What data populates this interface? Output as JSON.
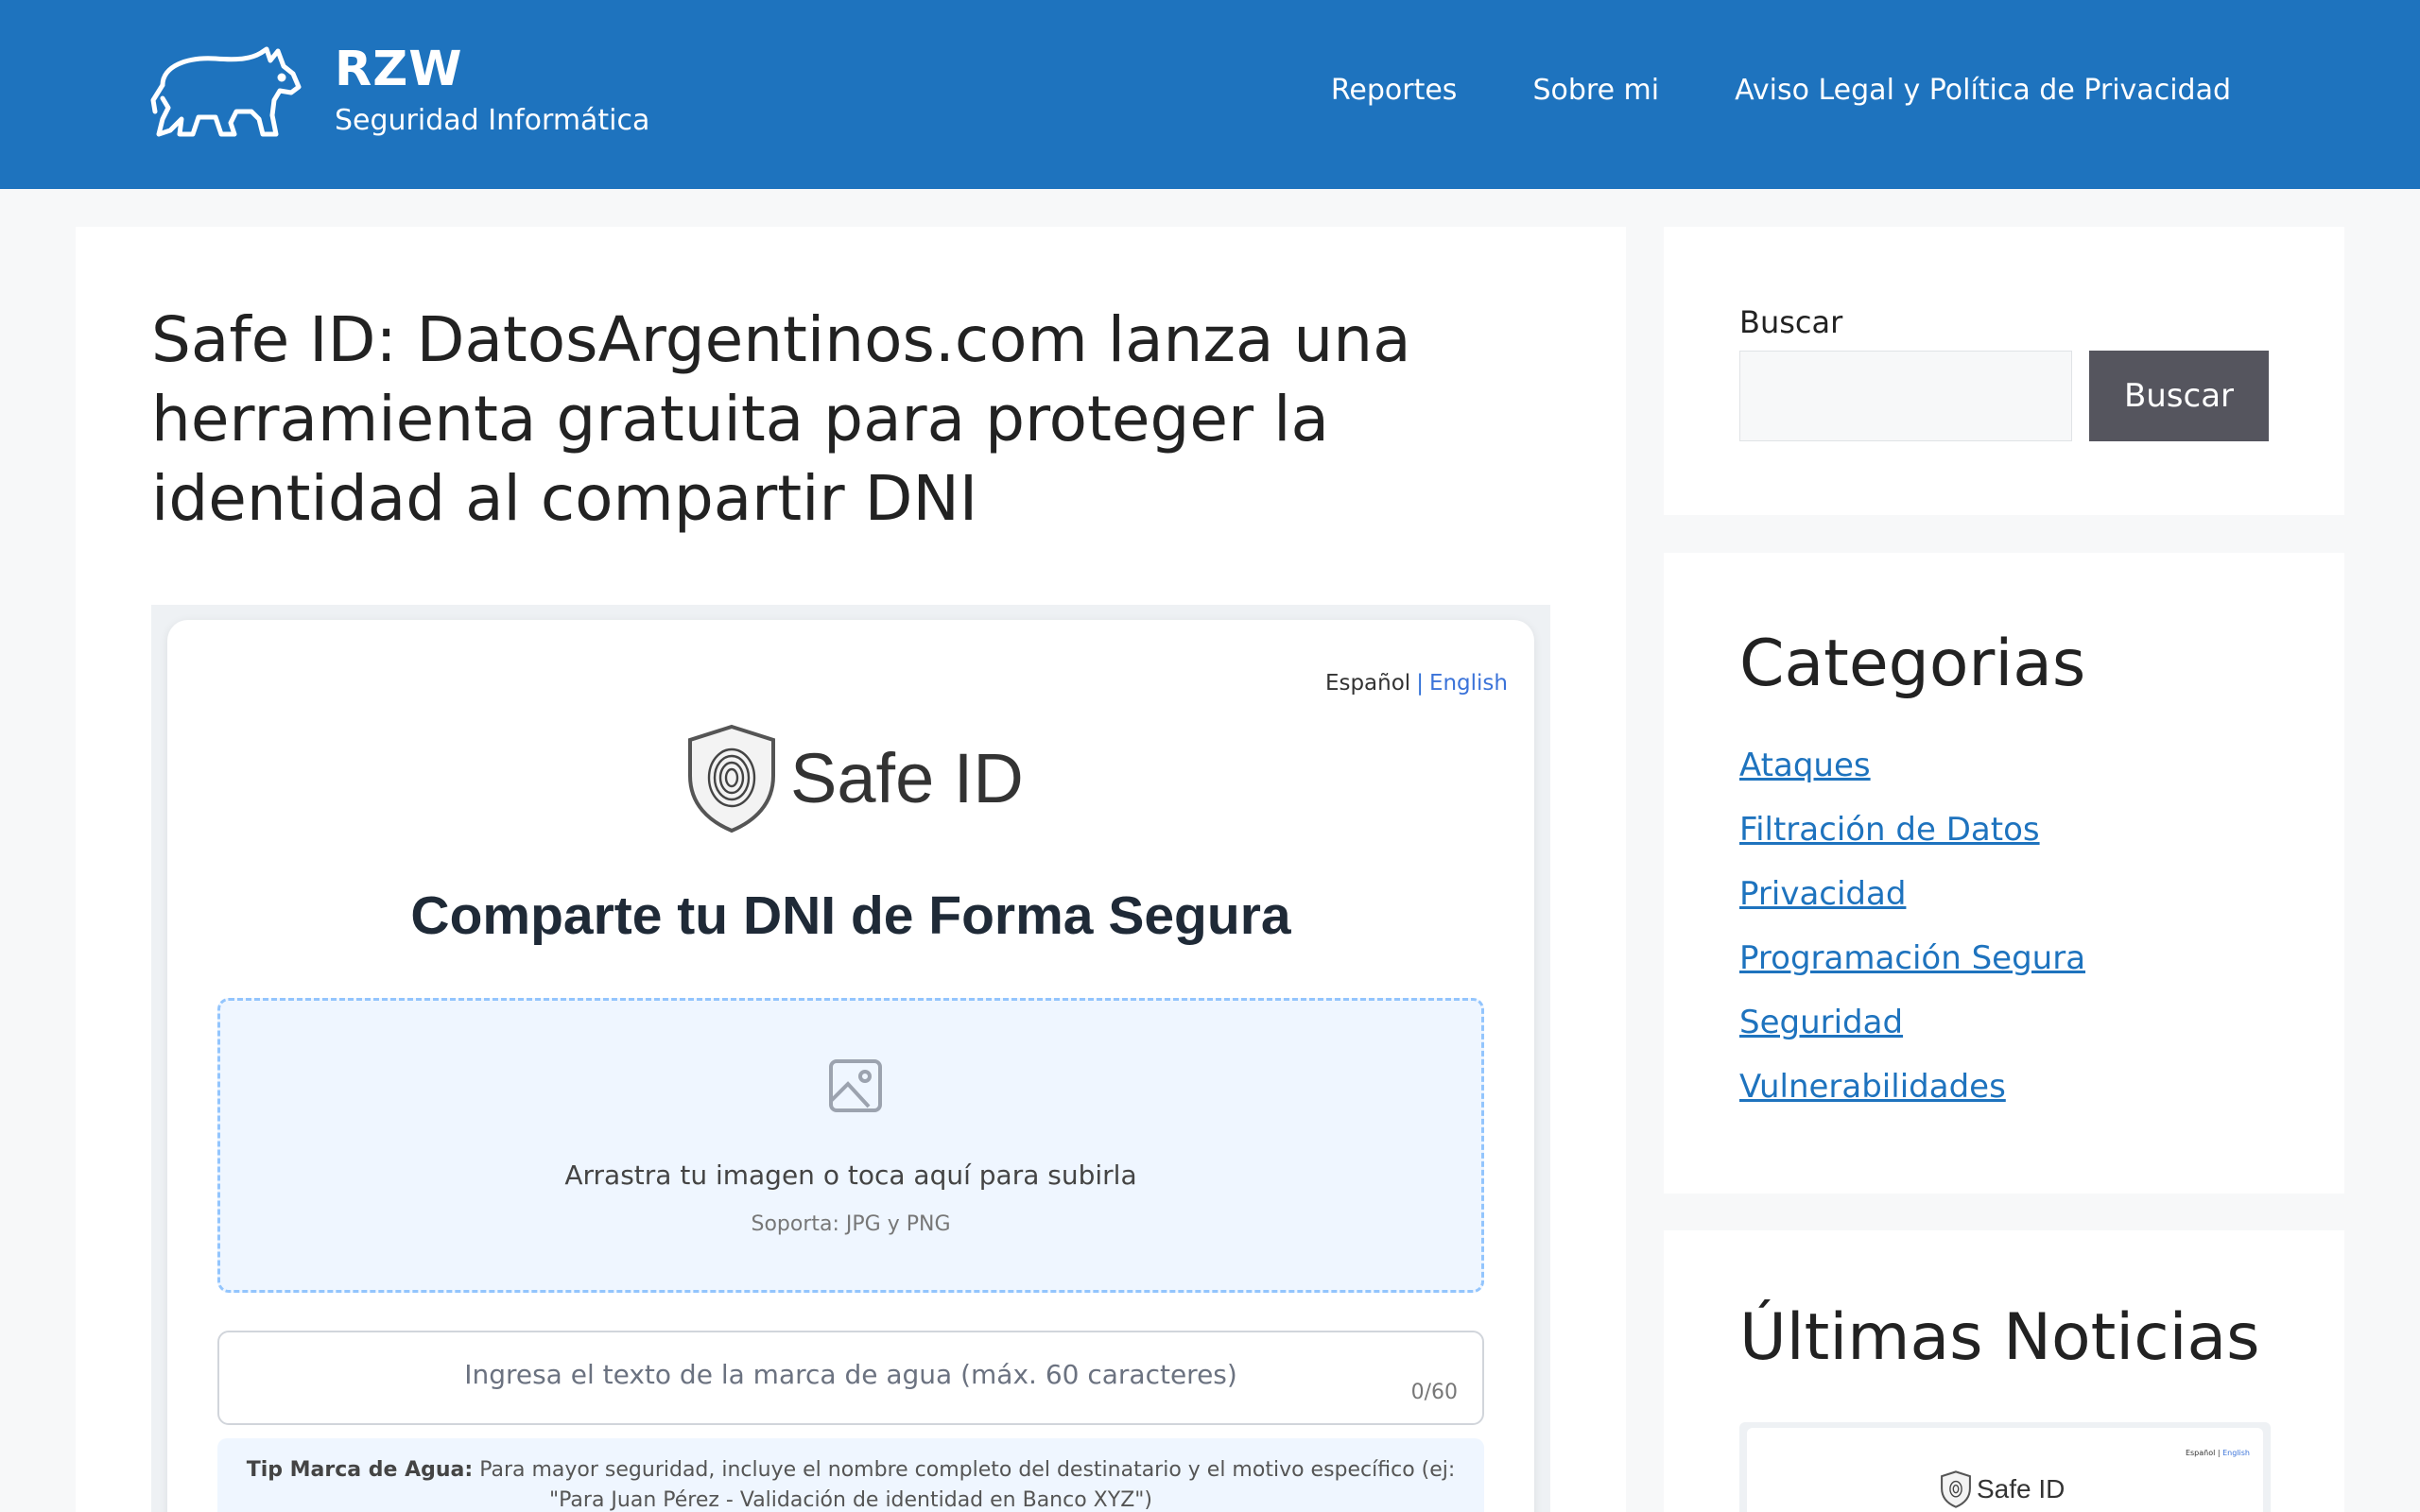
{
  "header": {
    "site_title": "RZW",
    "tagline": "Seguridad Informática",
    "logo_icon": "rhino-icon",
    "nav": [
      {
        "label": "Reportes"
      },
      {
        "label": "Sobre mi"
      },
      {
        "label": "Aviso Legal y Política de Privacidad"
      }
    ],
    "background": "#1e73be"
  },
  "article": {
    "title": "Safe ID: DatosArgentinos.com lanza una herramienta gratuita para proteger la identidad al compartir DNI",
    "image": {
      "language_switch": {
        "current": "Español",
        "separator": "|",
        "alternate": "English"
      },
      "logo_text": "Safe ID",
      "logo_icon": "shield-fingerprint-icon",
      "heading": "Comparte tu DNI de Forma Segura",
      "dropzone": {
        "icon": "image-icon",
        "text": "Arrastra tu imagen o toca aquí para subirla",
        "support": "Soporta: JPG y PNG"
      },
      "watermark_input": {
        "placeholder": "Ingresa el texto de la marca de agua (máx. 60 caracteres)",
        "value": "",
        "counter": "0/60"
      },
      "tip": {
        "label": "Tip Marca de Agua:",
        "text": "Para mayor seguridad, incluye el nombre completo del destinatario y el motivo específico (ej: \"Para Juan Pérez - Validación de identidad en Banco XYZ\")"
      }
    }
  },
  "sidebar": {
    "search": {
      "label": "Buscar",
      "input_value": "",
      "button_label": "Buscar"
    },
    "categories": {
      "heading": "Categorias",
      "items": [
        {
          "label": "Ataques"
        },
        {
          "label": "Filtración de Datos"
        },
        {
          "label": "Privacidad"
        },
        {
          "label": "Programación Segura"
        },
        {
          "label": "Seguridad"
        },
        {
          "label": "Vulnerabilidades"
        }
      ]
    },
    "latest_news": {
      "heading": "Últimas Noticias",
      "thumb": {
        "lang_current": "Español",
        "lang_alternate": "English",
        "logo_text": "Safe ID"
      }
    }
  },
  "colors": {
    "brand_blue": "#1e73be",
    "link_blue": "#1e73be",
    "button_dark": "#55555e",
    "dropzone_border": "#93c5fd"
  }
}
